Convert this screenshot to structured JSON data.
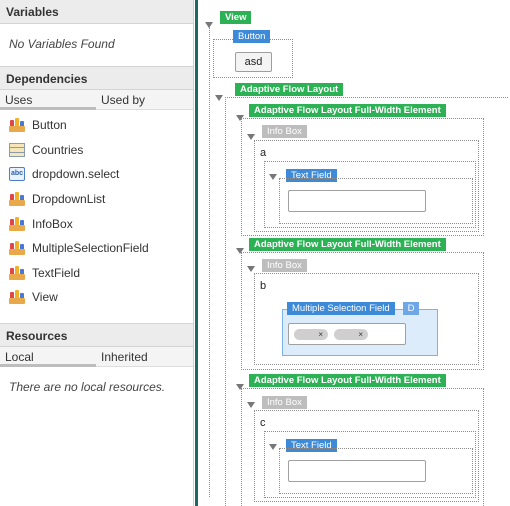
{
  "variables": {
    "title": "Variables",
    "empty": "No Variables Found"
  },
  "dependencies": {
    "title": "Dependencies",
    "tabs": {
      "uses": "Uses",
      "used_by": "Used by"
    },
    "items": [
      {
        "label": "Button",
        "icon": "component-icon"
      },
      {
        "label": "Countries",
        "icon": "table-icon"
      },
      {
        "label": "dropdown.select",
        "icon": "select-icon"
      },
      {
        "label": "DropdownList",
        "icon": "component-icon"
      },
      {
        "label": "InfoBox",
        "icon": "component-icon"
      },
      {
        "label": "MultipleSelectionField",
        "icon": "component-icon"
      },
      {
        "label": "TextField",
        "icon": "component-icon"
      },
      {
        "label": "View",
        "icon": "component-icon"
      }
    ]
  },
  "resources": {
    "title": "Resources",
    "tabs": {
      "local": "Local",
      "inherited": "Inherited"
    },
    "empty": "There are no local resources."
  },
  "tree": {
    "view": "View",
    "button": "Button",
    "button_text": "asd",
    "adaptive_flow_layout": "Adaptive Flow Layout",
    "full_width_element": "Adaptive Flow Layout Full-Width Element",
    "info_box": "Info Box",
    "text_field": "Text Field",
    "multiple_selection_field": "Multiple Selection Field",
    "d_badge": "D",
    "chip_remove": "×",
    "section_a": "a",
    "section_b": "b",
    "section_c": "c"
  },
  "colors": {
    "green": "#2db155",
    "blue": "#3c8ad8",
    "grey": "#bdbdbd",
    "teal_divider": "#1d6b5e",
    "selected_bg": "#dcecfb"
  }
}
